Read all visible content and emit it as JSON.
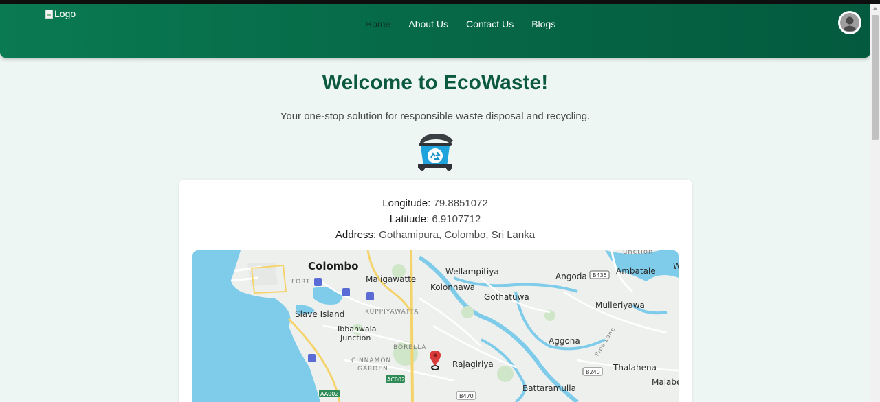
{
  "header": {
    "logo_alt": "Logo",
    "nav": [
      {
        "label": "Home",
        "active": true
      },
      {
        "label": "About Us",
        "active": false
      },
      {
        "label": "Contact Us",
        "active": false
      },
      {
        "label": "Blogs",
        "active": false
      }
    ]
  },
  "hero": {
    "title": "Welcome to EcoWaste!",
    "subtitle": "Your one-stop solution for responsible waste disposal and recycling."
  },
  "location": {
    "longitude_label": "Longitude:",
    "longitude": "79.8851072",
    "latitude_label": "Latitude:",
    "latitude": "6.9107712",
    "address_label": "Address:",
    "address": "Gothamipura, Colombo, Sri Lanka"
  },
  "map": {
    "places": {
      "colombo": "Colombo",
      "fort": "FORT",
      "maligawatte": "Maligawatte",
      "wellampitiya": "Wellampitiya",
      "kolonnawa": "Kolonnawa",
      "gothatuwa": "Gothatuwa",
      "angoda": "Angoda",
      "ambatale": "Ambatale",
      "junction": "Junction",
      "mulleriyawa": "Mulleriyawa",
      "slave_island": "Slave Island",
      "kuppiyawatta": "KUPPIYAWATTA",
      "ibbanwala": "Ibbanwala",
      "ibbanwala2": "Junction",
      "borella": "BORELLA",
      "aggona": "Aggona",
      "pipe_lane": "Pipe Lane",
      "cinnamon": "CINNAMON",
      "garden": "GARDEN",
      "rajagiriya": "Rajagiriya",
      "thalahena": "Thalahena",
      "malabe": "Malabe",
      "battaramulla": "Battaramulla",
      "edge_w": "W"
    },
    "shields": {
      "b435": "B435",
      "b240": "B240",
      "b470": "B470",
      "ac002": "AC002",
      "aa002": "AA002"
    },
    "colors": {
      "water": "#7ecbea",
      "land": "#eef0ee",
      "park": "#cfe6c8",
      "major_road": "#f5d36b",
      "marker": "#d93a3a"
    }
  },
  "icons": {
    "avatar": "user-avatar-icon",
    "bin": "recycle-bin-icon",
    "marker": "map-pin-icon"
  }
}
